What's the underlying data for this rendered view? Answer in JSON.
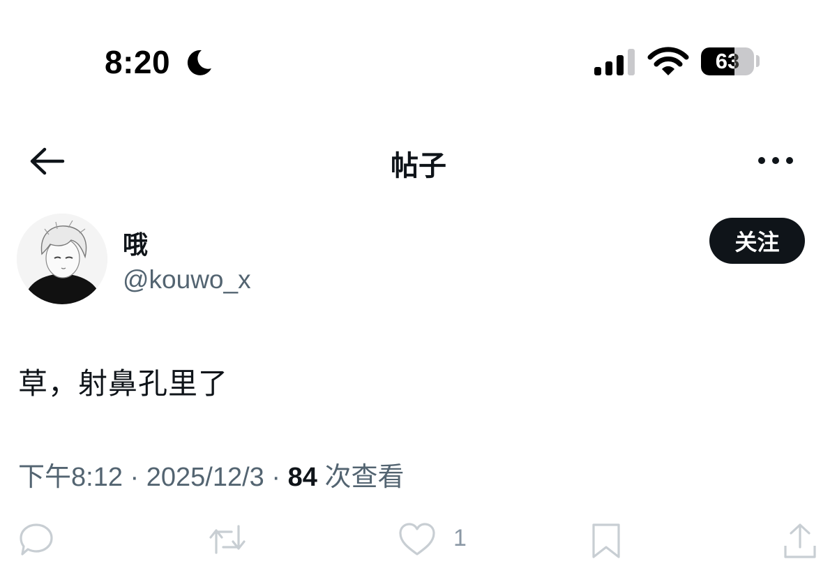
{
  "status_bar": {
    "time": "8:20",
    "focus_icon": "moon-icon",
    "signal_icon": "cellular-signal-icon",
    "wifi_icon": "wifi-icon",
    "battery_percent": "63",
    "battery_level": 0.63
  },
  "header": {
    "back_icon": "back-arrow-icon",
    "title": "帖子",
    "more_icon": "more-options-icon"
  },
  "author": {
    "name": "哦",
    "handle": "@kouwo_x",
    "follow_label": "关注"
  },
  "post": {
    "text": "草，射鼻孔里了",
    "time": "下午8:12",
    "date": "2025/12/3",
    "separator": "·",
    "views_count": "84",
    "views_label": "次查看"
  },
  "actions": {
    "reply_icon": "reply-icon",
    "repost_icon": "repost-icon",
    "like_icon": "heart-icon",
    "like_count": "1",
    "bookmark_icon": "bookmark-icon",
    "share_icon": "share-icon"
  },
  "colors": {
    "text_primary": "#0f1419",
    "text_secondary": "#536471",
    "button_bg": "#0f1419",
    "icon_gray": "#8b98a5"
  }
}
